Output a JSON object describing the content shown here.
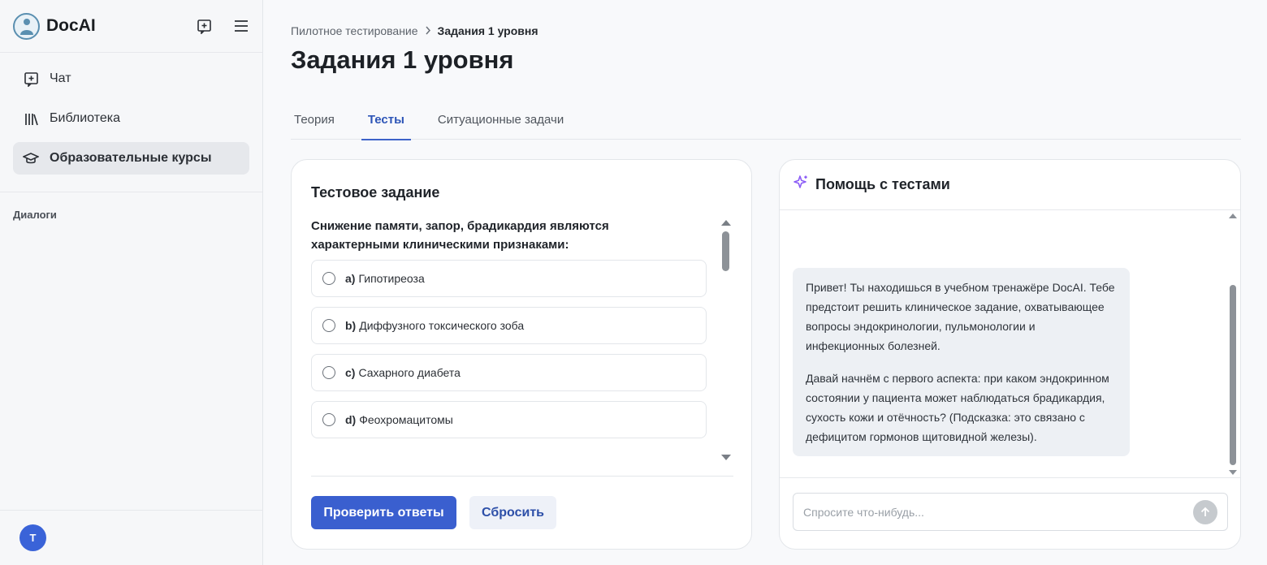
{
  "app": {
    "name": "DocAI"
  },
  "sidebar": {
    "nav": [
      {
        "label": "Чат",
        "icon": "chat-plus-icon"
      },
      {
        "label": "Библиотека",
        "icon": "library-icon"
      },
      {
        "label": "Образовательные курсы",
        "icon": "graduation-cap-icon",
        "active": true
      }
    ],
    "dialogs_label": "Диалоги",
    "user_initial": "T"
  },
  "breadcrumb": {
    "parent": "Пилотное тестирование",
    "current": "Задания 1 уровня"
  },
  "page_title": "Задания 1 уровня",
  "tabs": [
    {
      "label": "Теория"
    },
    {
      "label": "Тесты",
      "active": true
    },
    {
      "label": "Ситуационные задачи"
    }
  ],
  "test": {
    "title": "Тестовое задание",
    "question": "Снижение памяти, запор, брадикардия являются характерными клиническими признаками:",
    "options": [
      {
        "letter": "a)",
        "text": "Гипотиреоза"
      },
      {
        "letter": "b)",
        "text": "Диффузного токсического зоба"
      },
      {
        "letter": "c)",
        "text": "Сахарного диабета"
      },
      {
        "letter": "d)",
        "text": "Феохромацитомы"
      }
    ],
    "check_label": "Проверить ответы",
    "reset_label": "Сбросить"
  },
  "help": {
    "title": "Помощь с тестами",
    "message_p1": "Привет! Ты находишься в учебном тренажёре DocAI. Тебе предстоит решить клиническое задание, охватывающее вопросы эндокринологии, пульмонологии и инфекционных болезней.",
    "message_p2": "Давай начнём с первого аспекта: при каком эндокринном состоянии у пациента может наблюдаться брадикардия, сухость кожи и отёчность? (Подсказка: это связано с дефицитом гормонов щитовидной железы).",
    "input_placeholder": "Спросите что-нибудь..."
  },
  "colors": {
    "accent": "#3a5fcf",
    "sparkle": "#8b5cf6"
  }
}
